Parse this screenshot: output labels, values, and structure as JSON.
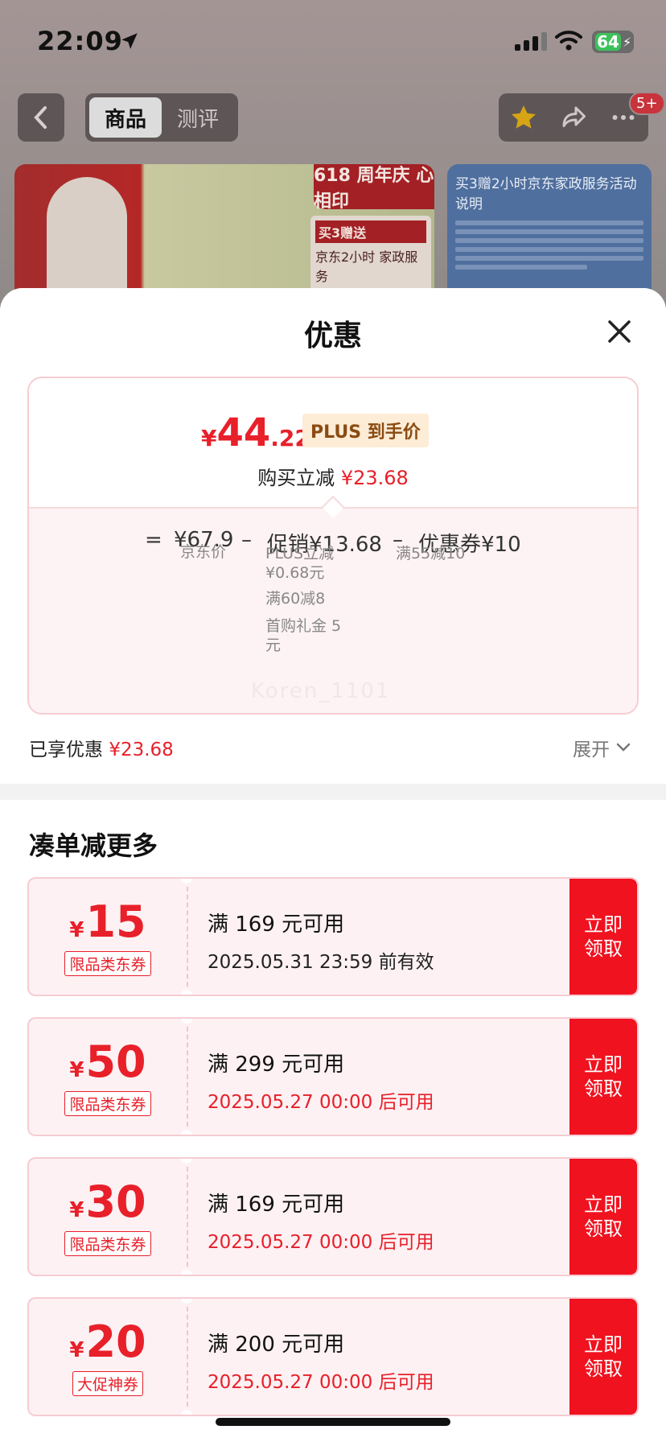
{
  "status_bar": {
    "time": "22:09",
    "battery": "64"
  },
  "header": {
    "tabs": [
      {
        "label": "商品",
        "active": true
      },
      {
        "label": "测评",
        "active": false
      }
    ],
    "badge": "5+"
  },
  "banner": {
    "left_tag": "618 周年庆 心相印",
    "left_promo_title": "买3赠送",
    "left_promo_text": "京东2小时 家政服务",
    "right_title": "买3赠2小时京东家政服务活动说明"
  },
  "sheet": {
    "title": "优惠",
    "price_card": {
      "yen": "¥",
      "price_int": "44",
      "price_dec": ".22",
      "tag": "PLUS 到手价",
      "save_prefix": "购买立减",
      "save_amount": "¥23.68",
      "eq": "=",
      "jd_price": "¥67.9",
      "minus": "–",
      "promo": "促销¥13.68",
      "coupon": "优惠券¥10",
      "jd_label": "京东价",
      "promo_details": [
        "PLUS立减 ¥0.68元",
        "满60减8",
        "首购礼金 5元"
      ],
      "coupon_detail": "满55减10",
      "watermark": "Koren_1101"
    },
    "enjoyed_label": "已享优惠",
    "enjoyed_amount": "¥23.68",
    "expand_label": "展开"
  },
  "more": {
    "title": "凑单减更多",
    "coupons": [
      {
        "yen": "¥",
        "amount": "15",
        "type": "限品类东券",
        "condition": "满 169 元可用",
        "validity": "2025.05.31 23:59 前有效",
        "validity_color": "gray",
        "button": "立即领取"
      },
      {
        "yen": "¥",
        "amount": "50",
        "type": "限品类东券",
        "condition": "满 299 元可用",
        "validity": "2025.05.27 00:00 后可用",
        "validity_color": "red",
        "button": "立即领取"
      },
      {
        "yen": "¥",
        "amount": "30",
        "type": "限品类东券",
        "condition": "满 169 元可用",
        "validity": "2025.05.27 00:00 后可用",
        "validity_color": "red",
        "button": "立即领取"
      },
      {
        "yen": "¥",
        "amount": "20",
        "type": "大促神券",
        "condition": "满 200 元可用",
        "validity": "2025.05.27 00:00 后可用",
        "validity_color": "red",
        "button": "立即领取"
      }
    ]
  }
}
